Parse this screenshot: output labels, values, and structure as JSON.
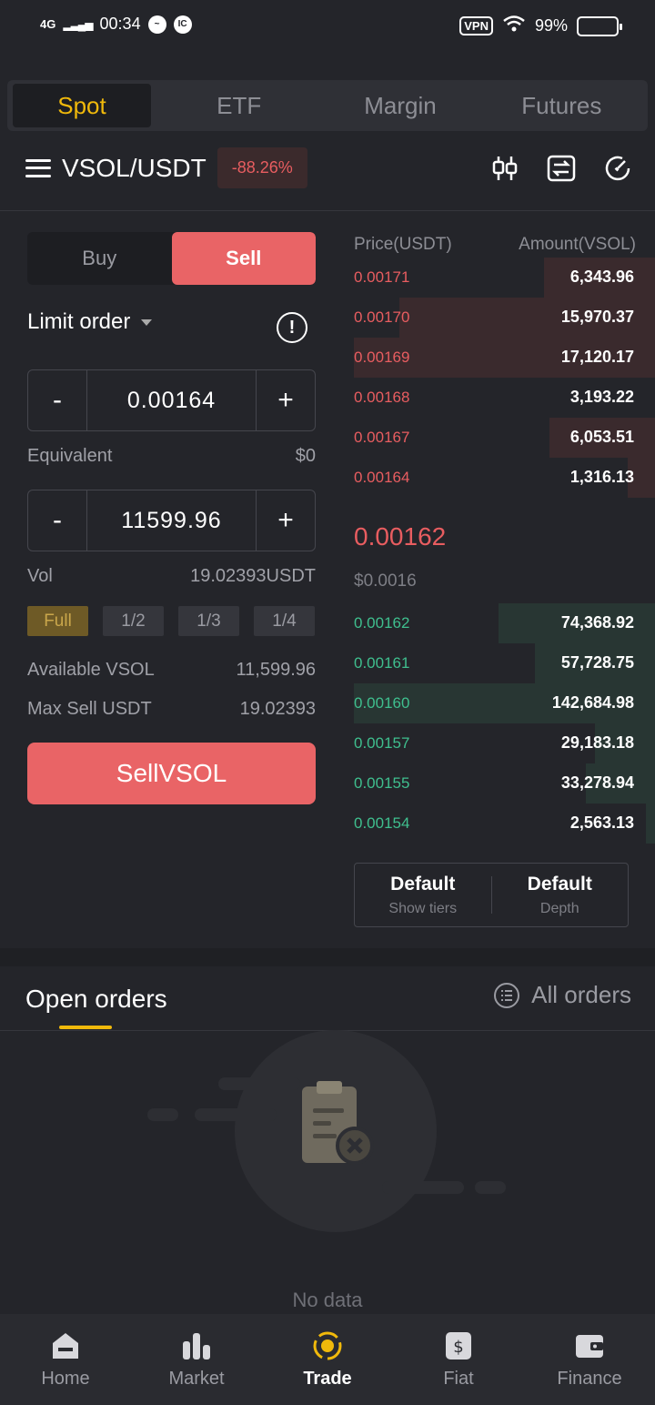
{
  "status_bar": {
    "network": "4G",
    "time": "00:34",
    "vpn": "VPN",
    "battery": "99%",
    "app_badge": "IC"
  },
  "tabs": [
    {
      "label": "Spot",
      "active": true
    },
    {
      "label": "ETF",
      "active": false
    },
    {
      "label": "Margin",
      "active": false
    },
    {
      "label": "Futures",
      "active": false
    }
  ],
  "pair": {
    "name": "VSOL/USDT",
    "change": "-88.26%"
  },
  "trade": {
    "buy_label": "Buy",
    "sell_label": "Sell",
    "order_type": "Limit order",
    "price": "0.00164",
    "equivalent_label": "Equivalent",
    "equivalent_value": "$0",
    "amount": "11599.96",
    "vol_label": "Vol",
    "vol_value": "19.02393USDT",
    "fractions": [
      "Full",
      "1/2",
      "1/3",
      "1/4"
    ],
    "available_label": "Available VSOL",
    "available_value": "11,599.96",
    "max_sell_label": "Max Sell USDT",
    "max_sell_value": "19.02393",
    "submit_label": "SellVSOL",
    "minus": "-",
    "plus": "+"
  },
  "order_book": {
    "price_header": "Price(USDT)",
    "amount_header": "Amount(VSOL)",
    "asks": [
      {
        "price": "0.00171",
        "amount": "6,343.96",
        "depth": 0.37
      },
      {
        "price": "0.00170",
        "amount": "15,970.37",
        "depth": 0.85
      },
      {
        "price": "0.00169",
        "amount": "17,120.17",
        "depth": 1.0
      },
      {
        "price": "0.00168",
        "amount": "3,193.22",
        "depth": 0.0
      },
      {
        "price": "0.00167",
        "amount": "6,053.51",
        "depth": 0.35
      },
      {
        "price": "0.00164",
        "amount": "1,316.13",
        "depth": 0.09
      }
    ],
    "last_price": "0.00162",
    "fiat_price": "$0.0016",
    "bids": [
      {
        "price": "0.00162",
        "amount": "74,368.92",
        "depth": 0.52
      },
      {
        "price": "0.00161",
        "amount": "57,728.75",
        "depth": 0.4
      },
      {
        "price": "0.00160",
        "amount": "142,684.98",
        "depth": 1.0
      },
      {
        "price": "0.00157",
        "amount": "29,183.18",
        "depth": 0.2
      },
      {
        "price": "0.00155",
        "amount": "33,278.94",
        "depth": 0.23
      },
      {
        "price": "0.00154",
        "amount": "2,563.13",
        "depth": 0.03
      }
    ],
    "tiers_title": "Default",
    "tiers_sub": "Show tiers",
    "depth_title": "Default",
    "depth_sub": "Depth"
  },
  "open_orders": {
    "title": "Open orders",
    "all_orders": "All orders",
    "empty": "No data"
  },
  "nav": [
    {
      "label": "Home",
      "icon": "home-icon",
      "active": false
    },
    {
      "label": "Market",
      "icon": "market-icon",
      "active": false
    },
    {
      "label": "Trade",
      "icon": "trade-icon",
      "active": true
    },
    {
      "label": "Fiat",
      "icon": "fiat-icon",
      "active": false
    },
    {
      "label": "Finance",
      "icon": "wallet-icon",
      "active": false
    }
  ],
  "colors": {
    "accent": "#f0b90b",
    "sell": "#e96466",
    "buy": "#3fbf8e",
    "background": "#24252a"
  }
}
